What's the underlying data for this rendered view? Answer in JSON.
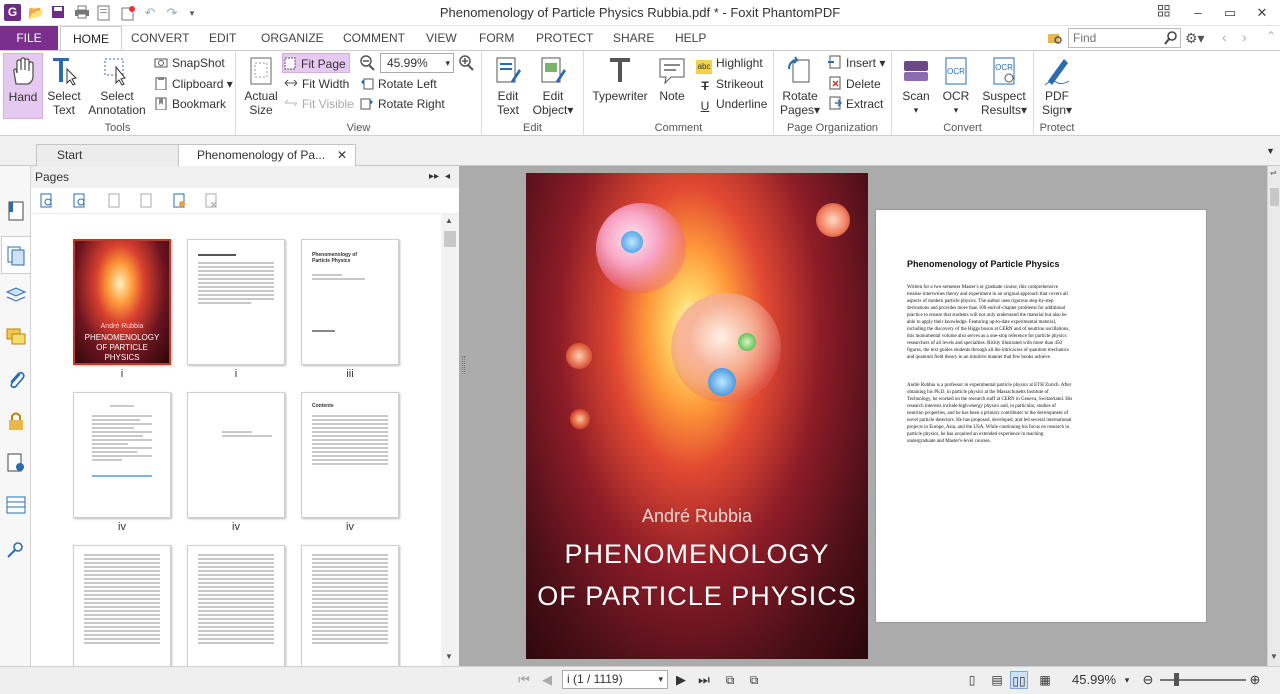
{
  "window": {
    "title": "Phenomenology of Particle Physics Rubbia.pdf * - Foxit PhantomPDF"
  },
  "menu_tabs": [
    "FILE",
    "HOME",
    "CONVERT",
    "EDIT",
    "ORGANIZE",
    "COMMENT",
    "VIEW",
    "FORM",
    "PROTECT",
    "SHARE",
    "HELP"
  ],
  "search": {
    "placeholder": "Find"
  },
  "ribbon": {
    "tools": {
      "group": "Tools",
      "hand": "Hand",
      "select_text_1": "Select",
      "select_text_2": "Text",
      "select_annot_1": "Select",
      "select_annot_2": "Annotation",
      "snapshot": "SnapShot",
      "clipboard": "Clipboard",
      "bookmark": "Bookmark"
    },
    "view": {
      "group": "View",
      "actual_1": "Actual",
      "actual_2": "Size",
      "fit_page": "Fit Page",
      "fit_width": "Fit Width",
      "fit_visible": "Fit Visible",
      "zoom": "45.99%",
      "rotate_left": "Rotate Left",
      "rotate_right": "Rotate Right"
    },
    "edit": {
      "group": "Edit",
      "edit_text_1": "Edit",
      "edit_text_2": "Text",
      "edit_object_1": "Edit",
      "edit_object_2": "Object"
    },
    "comment": {
      "group": "Comment",
      "typewriter": "Typewriter",
      "note": "Note",
      "highlight": "Highlight",
      "strikeout": "Strikeout",
      "underline": "Underline"
    },
    "page_org": {
      "group": "Page Organization",
      "rotate_1": "Rotate",
      "rotate_2": "Pages",
      "insert": "Insert",
      "delete": "Delete",
      "extract": "Extract"
    },
    "convert": {
      "group": "Convert",
      "scan": "Scan",
      "ocr": "OCR",
      "suspect_1": "Suspect",
      "suspect_2": "Results"
    },
    "protect": {
      "group": "Protect",
      "pdf_sign_1": "PDF",
      "pdf_sign_2": "Sign"
    }
  },
  "doc_tabs": {
    "start": "Start",
    "doc": "Phenomenology of Pa..."
  },
  "pages_panel": {
    "title": "Pages",
    "thumb_labels": [
      "i",
      "i",
      "iii",
      "iv",
      "iv",
      "iv"
    ],
    "cover_author": "André Rubbia",
    "cover_title": "PHENOMENOLOGY OF PARTICLE PHYSICS",
    "thumb2_title": "Phenomenology of Particle Physics",
    "thumb5_title": "Contents"
  },
  "document": {
    "cover_author": "André Rubbia",
    "cover_title_1": "PHENOMENOLOGY",
    "cover_title_2": "OF PARTICLE PHYSICS",
    "back_title": "Phenomenology of Particle Physics",
    "back_p1": "Written for a two-semester Master's or graduate course, this comprehensive treatise intertwines theory and experiment in an original approach that covers all aspects of modern particle physics. The author uses rigorous step-by-step derivations and provides more than 100 end-of-chapter problems for additional practice to ensure that students will not only understand the material but also be able to apply their knowledge. Featuring up-to-date experimental material, including the discovery of the Higgs boson at CERN and of neutrino oscillations, this monumental volume also serves as a one-stop reference for particle physics researchers of all levels and specialties. Richly illustrated with more than 450 figures, the text guides students through all the intricacies of quantum mechanics and quantum field theory in an intuitive manner that few books achieve.",
    "back_p2": "André Rubbia is a professor in experimental particle physics at ETH Zurich. After obtaining his Ph.D. in particle physics at the Massachusetts Institute of Technology, he worked on the research staff at CERN in Geneva, Switzerland. His research interests include high-energy physics and, in particular, studies of neutrino properties, and he has been a primary contributor to the development of novel particle detectors. He has proposed, developed, and led several international projects in Europe, Asia, and the USA. While continuing his focus on research in particle physics, he has acquired an extended experience in teaching undergraduate and Master's-level courses."
  },
  "status": {
    "page_display": "i (1 / 1119)",
    "zoom": "45.99%"
  },
  "colors": {
    "accent": "#7a2f8f",
    "selected": "#e6c9f0"
  }
}
